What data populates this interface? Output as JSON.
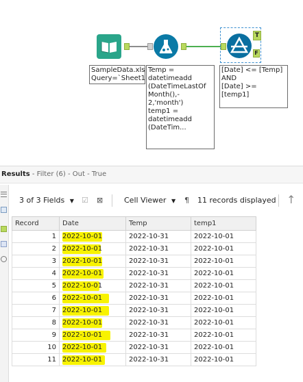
{
  "annotations": {
    "input": "SampleData.xlsx\nQuery=`Sheet1$`",
    "formula": "Temp =\ndatetimeadd\n(DateTimeLastOf\nMonth(),-\n2,'month')\ntemp1 =\ndatetimeadd\n(DateTim...",
    "filter": "[Date] <= [Temp]\nAND\n[Date] >=\n[temp1]"
  },
  "filter_anchors": {
    "true": "T",
    "false": "F"
  },
  "results": {
    "title": "Results",
    "subtitle": " - Filter (6) - Out - True"
  },
  "toolbar": {
    "fields": "3 of 3 Fields",
    "cell_viewer": "Cell Viewer",
    "records": "11 records displayed"
  },
  "table": {
    "columns": [
      "Record",
      "Date",
      "Temp",
      "temp1"
    ],
    "rows": [
      [
        "1",
        "2022-10-01",
        "2022-10-31",
        "2022-10-01"
      ],
      [
        "2",
        "2022-10-01",
        "2022-10-31",
        "2022-10-01"
      ],
      [
        "3",
        "2022-10-01",
        "2022-10-31",
        "2022-10-01"
      ],
      [
        "4",
        "2022-10-01",
        "2022-10-31",
        "2022-10-01"
      ],
      [
        "5",
        "2022-10-01",
        "2022-10-31",
        "2022-10-01"
      ],
      [
        "6",
        "2022-10-01",
        "2022-10-31",
        "2022-10-01"
      ],
      [
        "7",
        "2022-10-01",
        "2022-10-31",
        "2022-10-01"
      ],
      [
        "8",
        "2022-10-01",
        "2022-10-31",
        "2022-10-01"
      ],
      [
        "9",
        "2022-10-01",
        "2022-10-31",
        "2022-10-01"
      ],
      [
        "10",
        "2022-10-01",
        "2022-10-31",
        "2022-10-01"
      ],
      [
        "11",
        "2022-10-01",
        "2022-10-31",
        "2022-10-01"
      ]
    ]
  },
  "colors": {
    "input_tool": "#2aa58a",
    "formula_tool": "#0a7aa6",
    "filter_tool": "#0a6fa0",
    "connector": "#4caf50",
    "highlight": "#f8f300"
  }
}
